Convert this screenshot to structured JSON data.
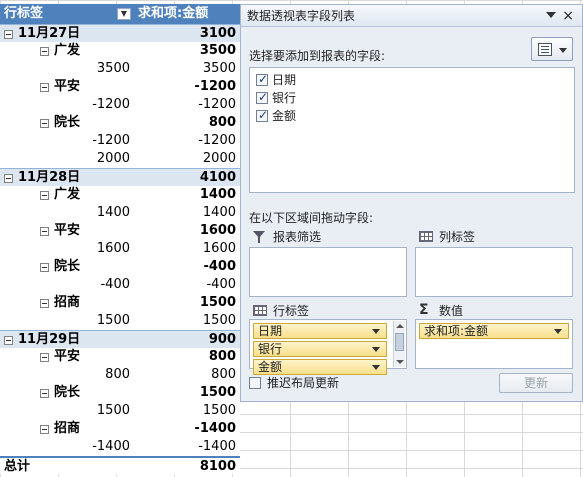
{
  "pivot": {
    "header": {
      "label": "行标签",
      "value_label": "求和项:金额"
    },
    "groups": [
      {
        "date": "11月27日",
        "total": "3100",
        "banks": [
          {
            "name": "广发",
            "total": "3500",
            "details": [
              {
                "amount": "3500",
                "value": "3500"
              }
            ]
          },
          {
            "name": "平安",
            "total": "-1200",
            "details": [
              {
                "amount": "-1200",
                "value": "-1200"
              }
            ]
          },
          {
            "name": "院长",
            "total": "800",
            "details": [
              {
                "amount": "-1200",
                "value": "-1200"
              },
              {
                "amount": "2000",
                "value": "2000"
              }
            ]
          }
        ]
      },
      {
        "date": "11月28日",
        "total": "4100",
        "banks": [
          {
            "name": "广发",
            "total": "1400",
            "details": [
              {
                "amount": "1400",
                "value": "1400"
              }
            ]
          },
          {
            "name": "平安",
            "total": "1600",
            "details": [
              {
                "amount": "1600",
                "value": "1600"
              }
            ]
          },
          {
            "name": "院长",
            "total": "-400",
            "details": [
              {
                "amount": "-400",
                "value": "-400"
              }
            ]
          },
          {
            "name": "招商",
            "total": "1500",
            "details": [
              {
                "amount": "1500",
                "value": "1500"
              }
            ]
          }
        ]
      },
      {
        "date": "11月29日",
        "total": "900",
        "banks": [
          {
            "name": "平安",
            "total": "800",
            "details": [
              {
                "amount": "800",
                "value": "800"
              }
            ]
          },
          {
            "name": "院长",
            "total": "1500",
            "details": [
              {
                "amount": "1500",
                "value": "1500"
              }
            ]
          },
          {
            "name": "招商",
            "total": "-1400",
            "details": [
              {
                "amount": "-1400",
                "value": "-1400"
              }
            ]
          }
        ]
      }
    ],
    "grand_total": {
      "label": "总计",
      "value": "8100"
    }
  },
  "field_list": {
    "title": "数据透视表字段列表",
    "choose_label": "选择要添加到报表的字段:",
    "fields": [
      {
        "name": "日期",
        "checked": true
      },
      {
        "name": "银行",
        "checked": true
      },
      {
        "name": "金额",
        "checked": true
      }
    ],
    "drag_label": "在以下区域间拖动字段:",
    "areas": {
      "filter": "报表筛选",
      "columns": "列标签",
      "rows": "行标签",
      "values": "数值"
    },
    "row_chips": [
      "日期",
      "银行",
      "金额"
    ],
    "value_chips": [
      "求和项:金额"
    ],
    "defer_label": "推迟布局更新",
    "update_label": "更新"
  },
  "colors": {
    "header_blue": "#4f81bd",
    "date_row_bg": "#dce6f1",
    "chip_yellow": "#f7df8a",
    "panel_bg": "#e9eef5"
  }
}
